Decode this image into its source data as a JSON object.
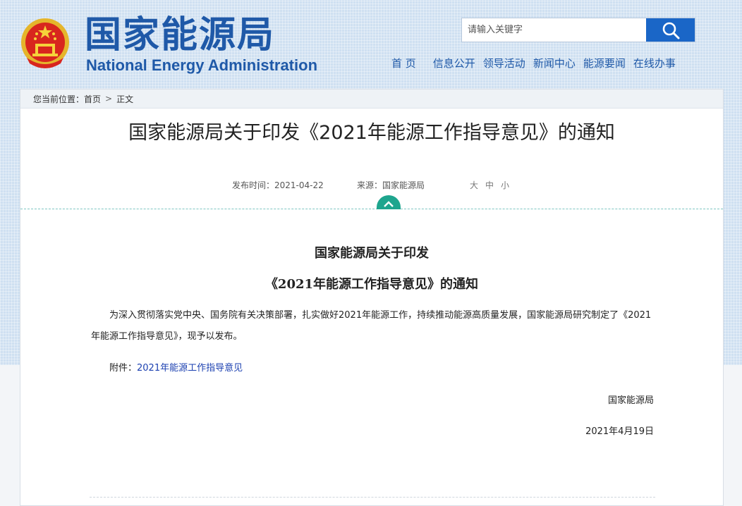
{
  "header": {
    "logo_cn": "国家能源局",
    "logo_en": "National Energy Administration",
    "emblem_icon": "national-emblem-icon"
  },
  "search": {
    "placeholder": "请输入关键字",
    "button_icon": "search-icon"
  },
  "nav": {
    "items": [
      {
        "label": "首 页"
      },
      {
        "label": "信息公开"
      },
      {
        "label": "领导活动"
      },
      {
        "label": "新闻中心"
      },
      {
        "label": "能源要闻"
      },
      {
        "label": "在线办事"
      }
    ]
  },
  "breadcrumb": {
    "prefix": "您当前位置：",
    "home": "首页",
    "separator": ">",
    "current": "正文"
  },
  "article": {
    "title": "国家能源局关于印发《2021年能源工作指导意见》的通知",
    "published": "发布时间：2021-04-22",
    "source": "来源：国家能源局",
    "font_sizes": [
      "大",
      "中",
      "小"
    ],
    "toggle_icon": "chevron-up-icon"
  },
  "document": {
    "title_line1": "国家能源局关于印发",
    "title_line2": "《2021年能源工作指导意见》的通知",
    "paragraph": "为深入贯彻落实党中央、国务院有关决策部署，扎实做好2021年能源工作，持续推动能源高质量发展，国家能源局研究制定了《2021年能源工作指导意见》，现予以发布。",
    "attachment_label": "附件：",
    "attachment_link": "2021年能源工作指导意见",
    "signature": "国家能源局",
    "date": "2021年4月19日"
  },
  "colors": {
    "brand_blue": "#1f59a8",
    "search_button": "#1a66c7",
    "toggle_green": "#1ea58e",
    "link_blue": "#1a3fb0"
  }
}
